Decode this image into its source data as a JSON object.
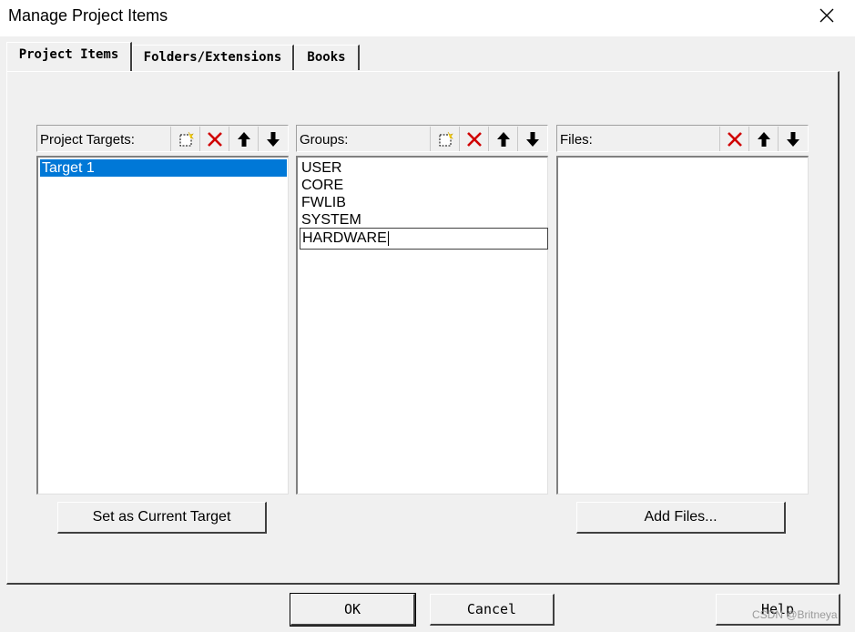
{
  "window": {
    "title": "Manage Project Items",
    "close_glyph": "✕"
  },
  "tabs": [
    {
      "label": "Project Items"
    },
    {
      "label": "Folders/Extensions"
    },
    {
      "label": "Books"
    }
  ],
  "targets": {
    "label": "Project Targets:",
    "items": [
      "Target 1"
    ],
    "selected_index": 0
  },
  "groups": {
    "label": "Groups:",
    "items": [
      "USER",
      "CORE",
      "FWLIB",
      "SYSTEM",
      "HARDWARE"
    ],
    "editing_index": 4
  },
  "files": {
    "label": "Files:",
    "items": []
  },
  "buttons": {
    "set_current_target": "Set as Current Target",
    "add_files": "Add Files...",
    "ok": "OK",
    "cancel": "Cancel",
    "help": "Help"
  },
  "watermark": "CSDN @Britneya",
  "icons": {
    "new": "new-item-icon",
    "delete": "delete-icon",
    "move_up": "move-up-icon",
    "move_down": "move-down-icon"
  },
  "colors": {
    "selection": "#0078d7",
    "delete_red": "#d00000"
  }
}
